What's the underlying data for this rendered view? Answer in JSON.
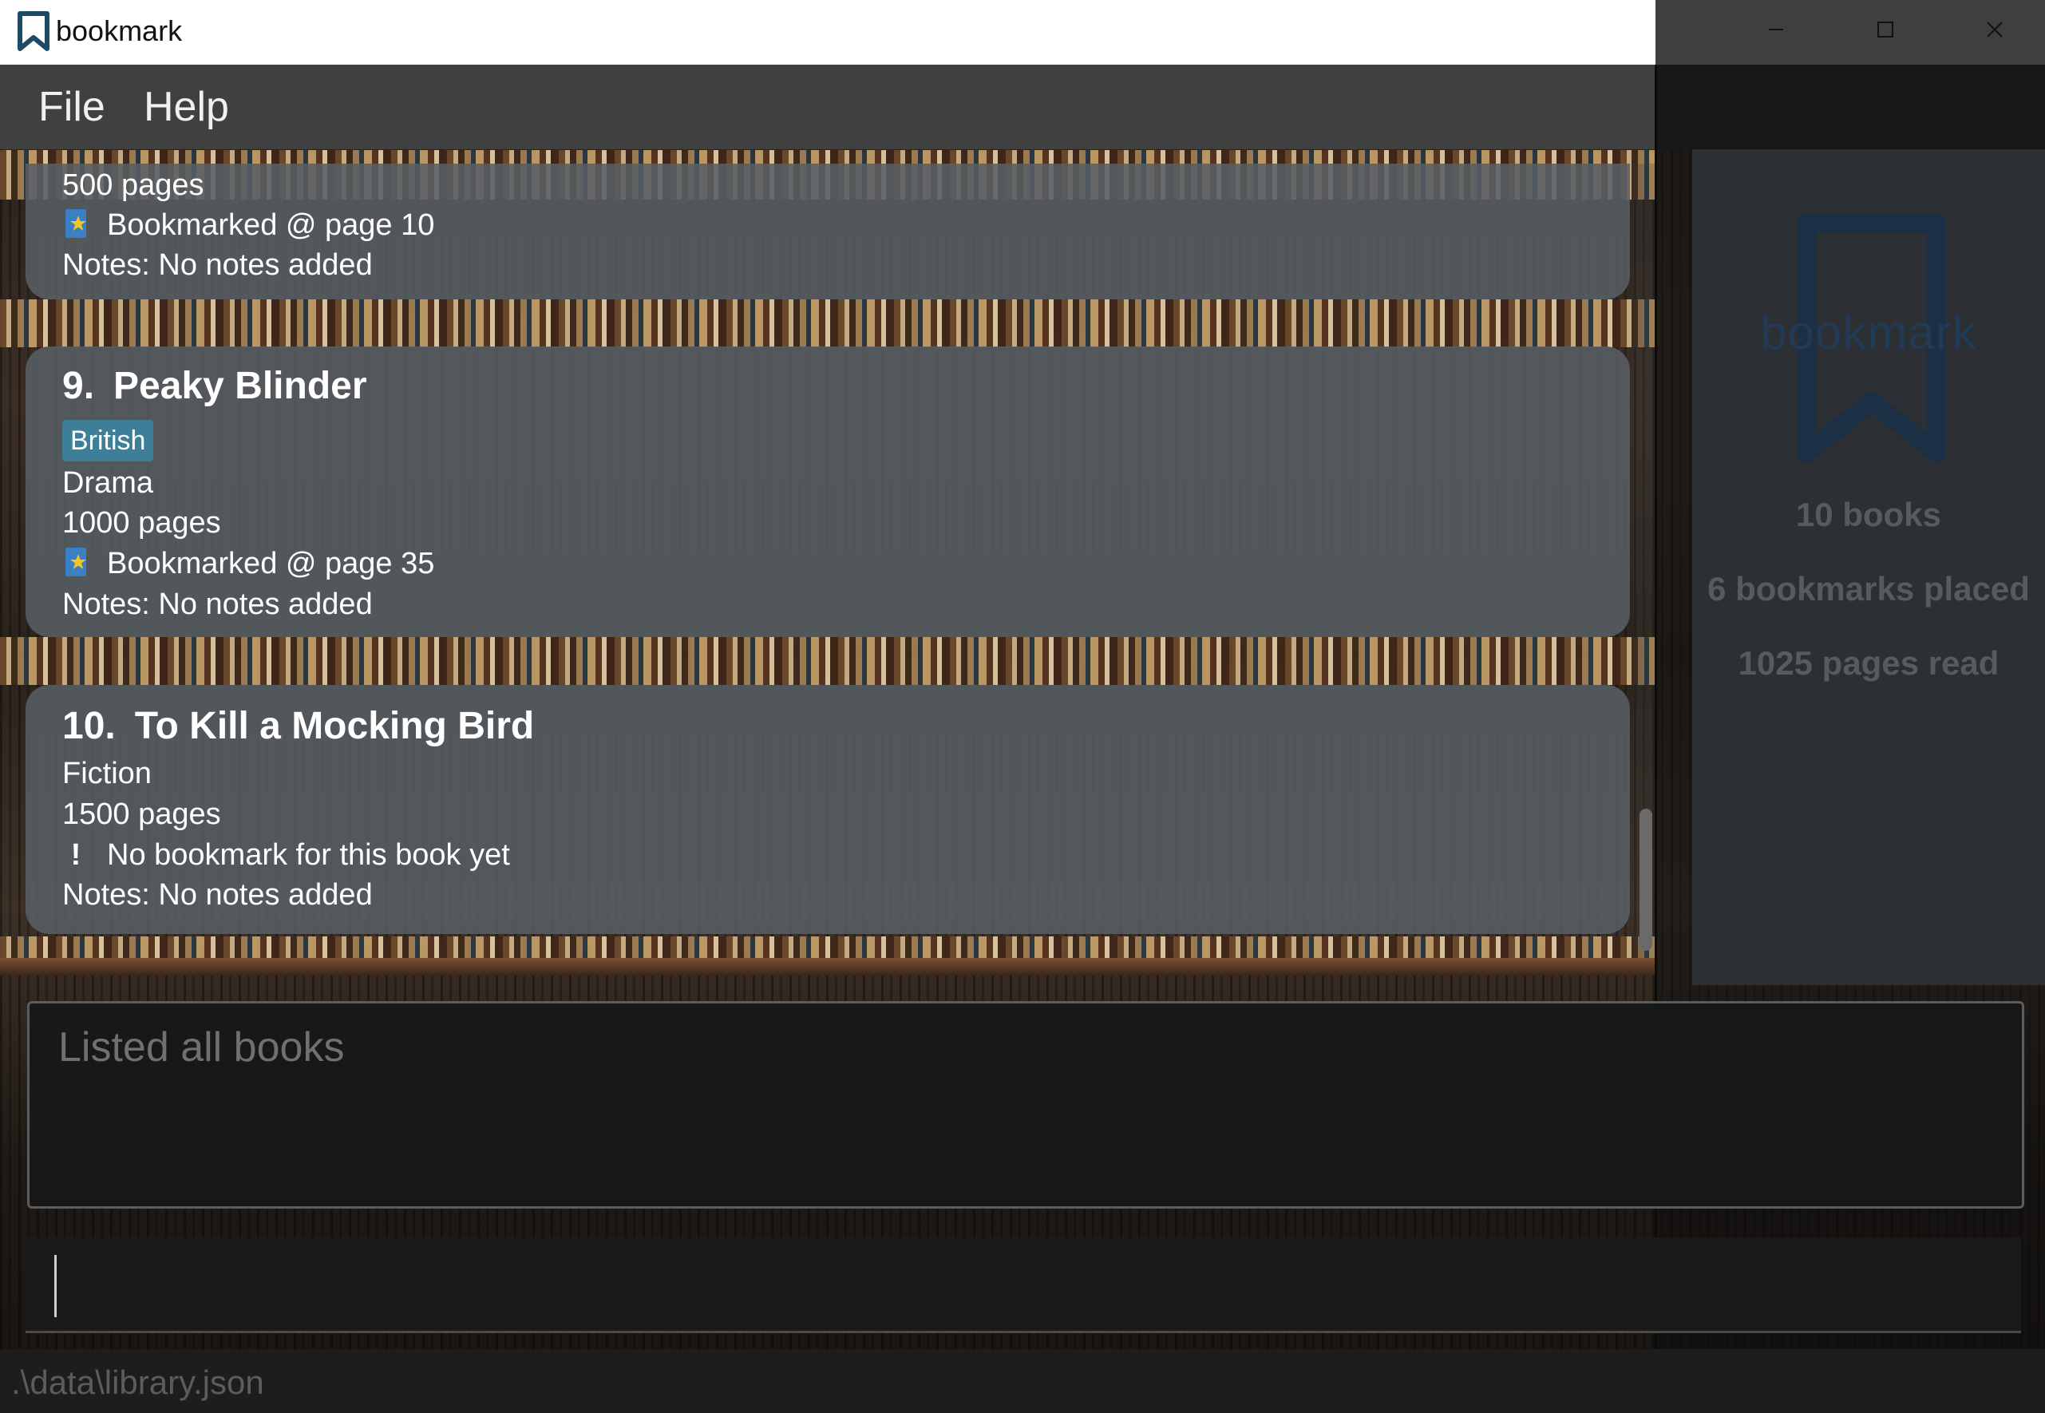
{
  "window": {
    "title": "bookmark"
  },
  "menu": {
    "file": "File",
    "help": "Help"
  },
  "books": {
    "partial": {
      "pages": "500 pages",
      "bookmark": "Bookmarked @ page 10",
      "notes": "Notes: No notes added"
    },
    "book9": {
      "index": "9.",
      "title": "Peaky Blinder",
      "tag": "British",
      "genre": "Drama",
      "pages": "1000 pages",
      "bookmark": "Bookmarked @ page 35",
      "notes": "Notes: No notes added"
    },
    "book10": {
      "index": "10.",
      "title": "To Kill a Mocking Bird",
      "genre": "Fiction",
      "pages": "1500 pages",
      "bookmark": "No bookmark for this book yet",
      "notes": "Notes: No notes added"
    }
  },
  "icons": {
    "bookmark": "bookmark-star-icon",
    "no_bookmark": "exclamation-icon",
    "app": "bookmark-icon",
    "minimize": "minimize-icon",
    "maximize": "maximize-icon",
    "close": "close-icon"
  },
  "summary": {
    "logo_text": "bookmark",
    "books": "10 books",
    "bookmarks": "6 bookmarks placed",
    "pages_read": "1025 pages read"
  },
  "result": {
    "text": "Listed all books"
  },
  "command": {
    "value": ""
  },
  "status": {
    "path": ".\\data\\library.json"
  },
  "colors": {
    "accent_tag": "#3d7e99",
    "card_bg": "#585f64",
    "logo": "#1f3550"
  },
  "scroll": {
    "position_fraction": 1.0
  }
}
